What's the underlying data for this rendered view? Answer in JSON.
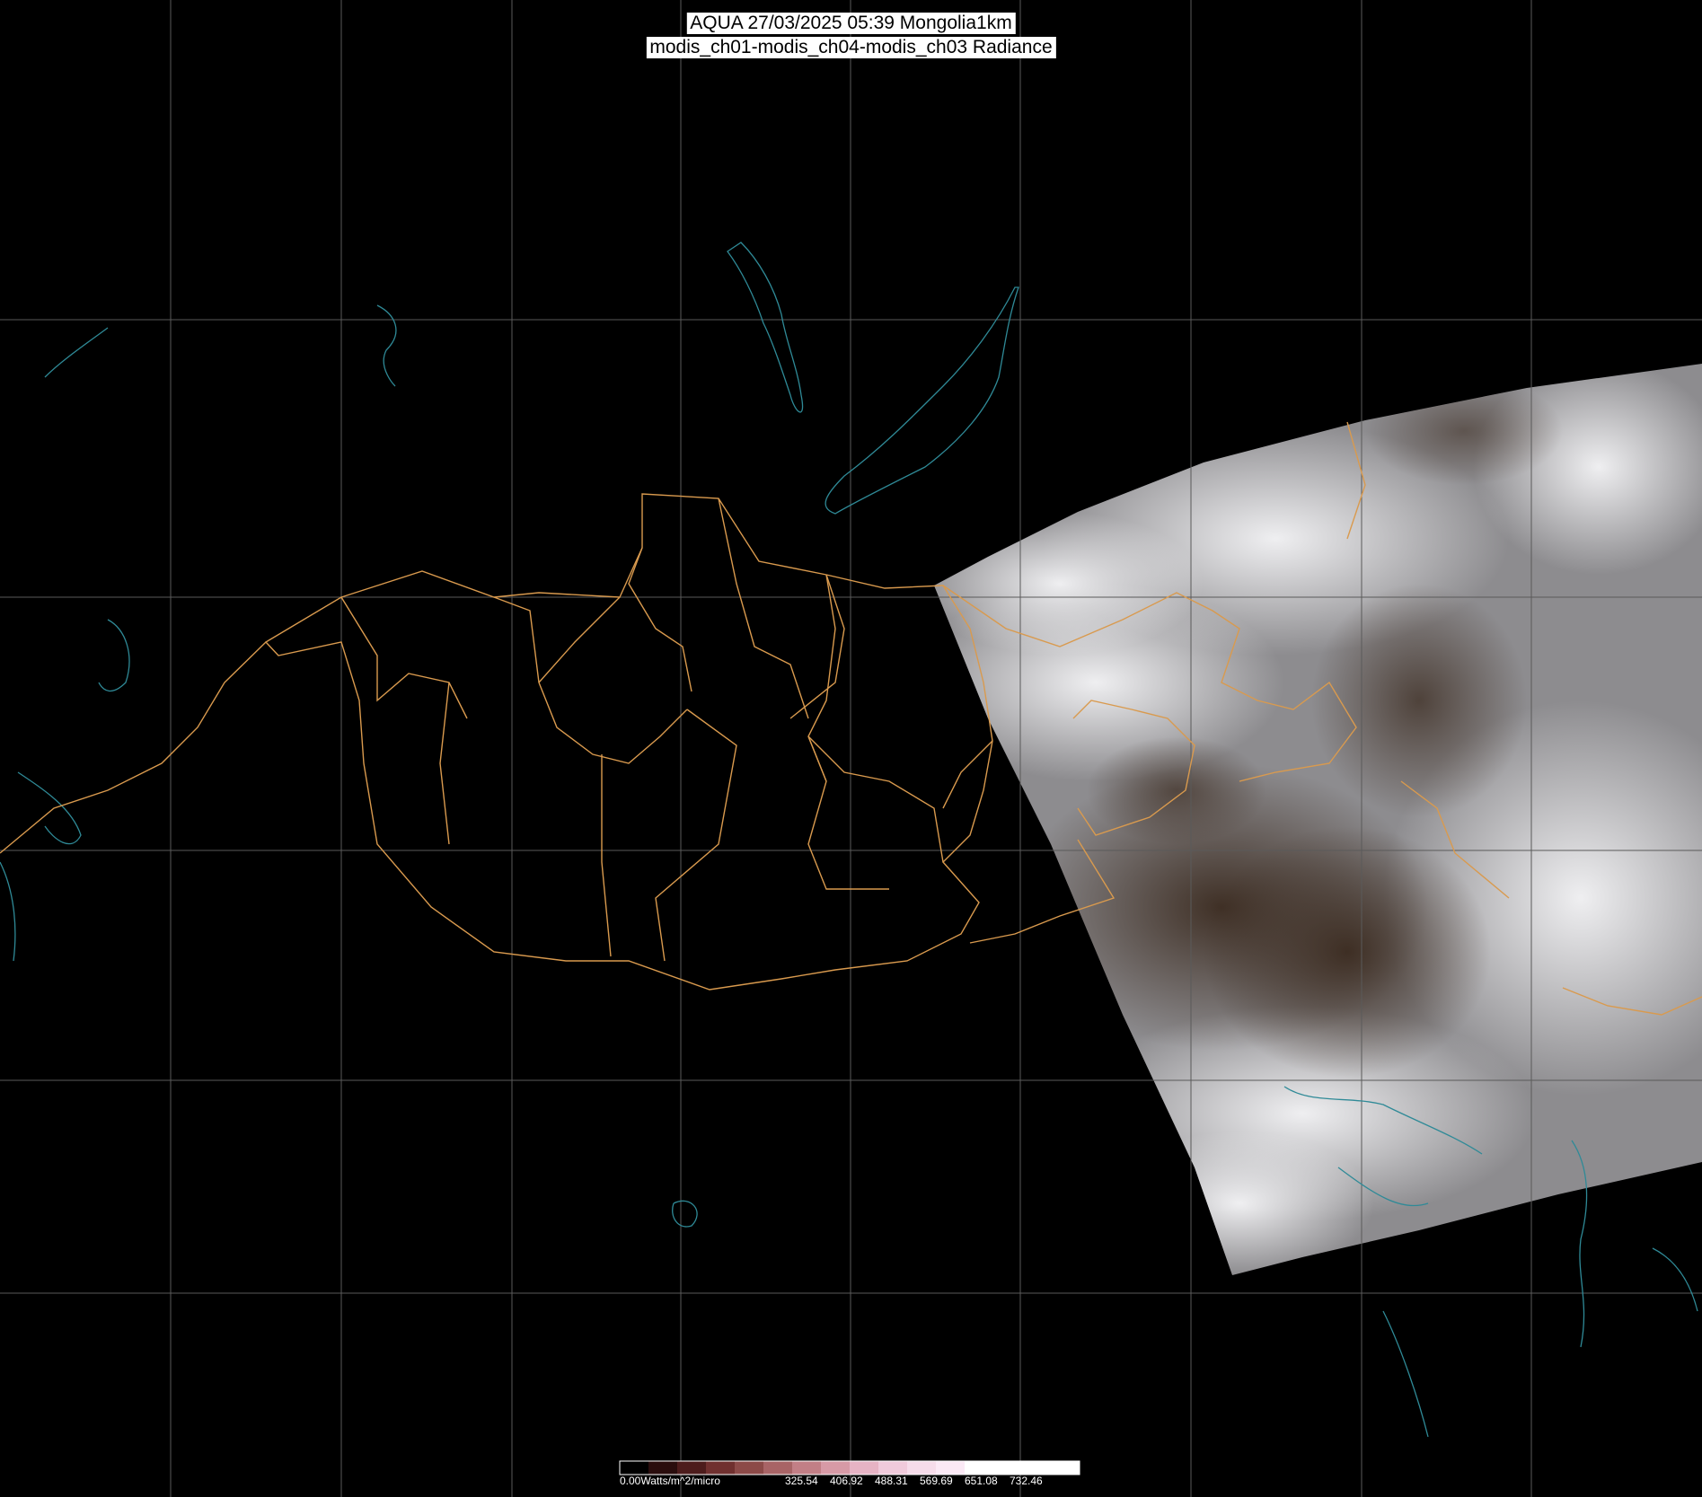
{
  "header": {
    "line1": "AQUA 27/03/2025 05:39 Mongolia1km",
    "line2": "modis_ch01-modis_ch04-modis_ch03 Radiance"
  },
  "legend": {
    "unit_label": "0.00Watts/m^2/micro",
    "ticks": [
      "325.54",
      "406.92",
      "488.31",
      "569.69",
      "651.08",
      "732.46"
    ],
    "colors": [
      "#000000",
      "#2a0d0d",
      "#4d1c1c",
      "#70302f",
      "#8c4a48",
      "#a86466",
      "#c27f86",
      "#d79aa6",
      "#e6b3c4",
      "#f0cadb",
      "#f6dcea",
      "#fbe9f5",
      "#ffffff",
      "#ffffff",
      "#ffffff",
      "#ffffff"
    ]
  },
  "colors": {
    "grid": "#5a5a5a",
    "border": "#d99a4e",
    "coast": "#2f8a97",
    "cloud": "#e8e8ea",
    "ground": "#3a2c25"
  }
}
